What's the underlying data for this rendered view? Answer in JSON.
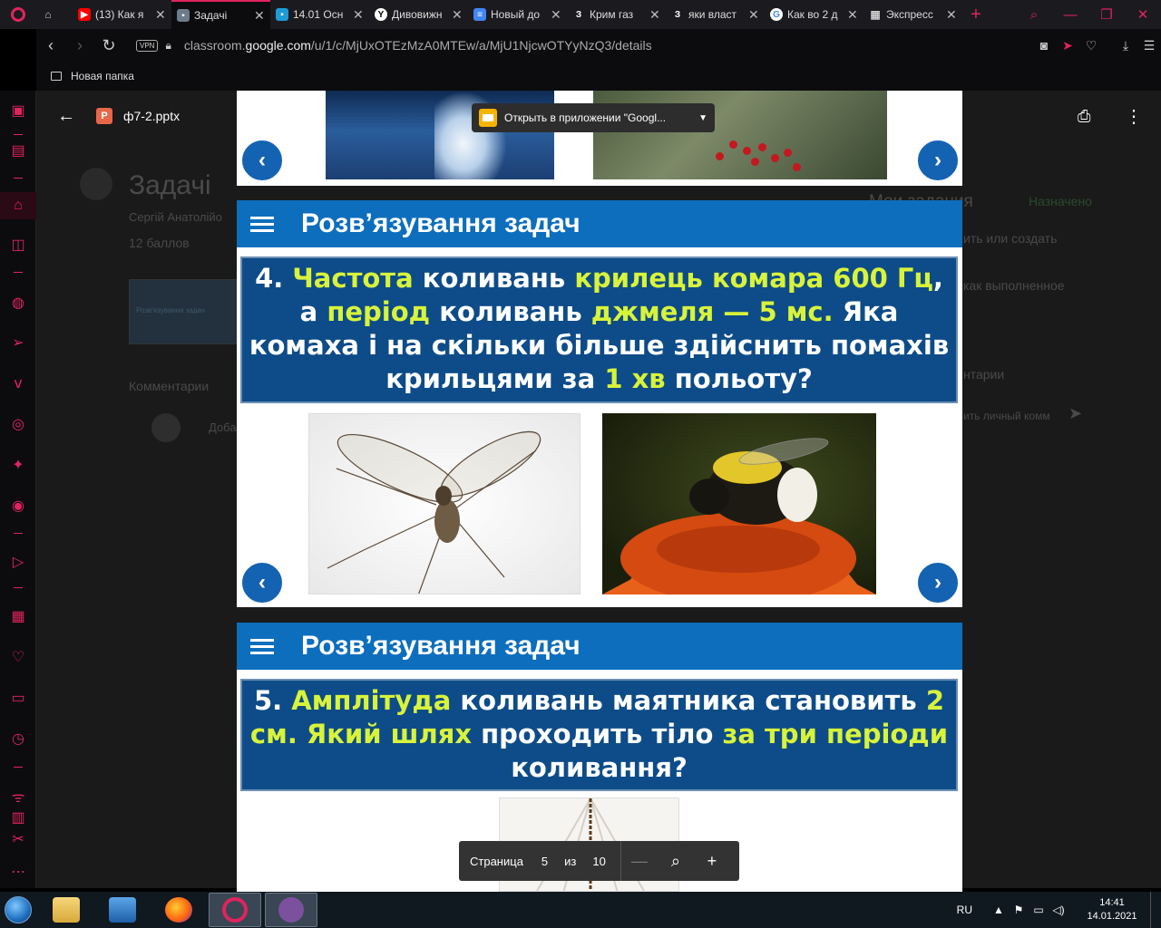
{
  "browser": {
    "tabs": [
      {
        "title": "",
        "favicon": "controller-icon",
        "color": "#1b1b1f"
      },
      {
        "title": "(13) Как я",
        "favicon": "youtube-icon",
        "color": "#ff0000"
      },
      {
        "title": "Задачі",
        "favicon": "classroom-icon",
        "color": "#1e8e3e",
        "active": true
      },
      {
        "title": "14.01 Осн",
        "favicon": "classroom-icon",
        "color": "#0f9d58"
      },
      {
        "title": "Дивовижн",
        "favicon": "yandex-icon",
        "color": "#ffffff"
      },
      {
        "title": "Новый до",
        "favicon": "docs-icon",
        "color": "#4285f4"
      },
      {
        "title": "Крим газ",
        "favicon": "z-icon",
        "color": "#1b1b1f"
      },
      {
        "title": "яки власт",
        "favicon": "z-icon",
        "color": "#1b1b1f"
      },
      {
        "title": "Как во 2 д",
        "favicon": "google-icon",
        "color": "#ffffff"
      },
      {
        "title": "Экспресс",
        "favicon": "grid-icon",
        "color": "#1b1b1f"
      }
    ],
    "tab_glyphs": {
      "z": "З",
      "close": "✕",
      "new_tab": "+"
    },
    "vpn_label": "VPN",
    "url_prefix": "classroom.",
    "url_domain": "google.com",
    "url_path": "/u/1/c/MjUxOTEzMzA0MTEw/a/MjU1NjcwOTYyNzQ3/details",
    "bookmark_folder": "Новая папка",
    "accent": "#e0245e"
  },
  "viewer": {
    "file_name": "ф7-2.pptx",
    "file_icon_letter": "P",
    "open_in_app": "Открыть в приложении \"Googl...",
    "page_label": "Страница",
    "page_current": "5",
    "page_of": "из",
    "page_total": "10"
  },
  "classroom_bg": {
    "title": "Задачі",
    "author": "Сергій Анатолійо",
    "points": "12 баллов",
    "attachment_title": "Розв'язування задач",
    "comments": "Комментарии",
    "comment_placeholder": "Доба",
    "my_work": "Мои задания",
    "assigned": "Назначено",
    "add_create": "ить или создать",
    "mark_done": "как выполненное",
    "private_comments": "нтарии",
    "private_placeholder": "ить личный комм"
  },
  "slides": [
    {
      "header": "Розв’язування задач",
      "question_parts": [
        {
          "t": "4.  ",
          "hl": false
        },
        {
          "t": "Частота",
          "hl": true
        },
        {
          "t": " коливань ",
          "hl": false
        },
        {
          "t": "крилець комара",
          "hl": true
        },
        {
          "t": " ",
          "hl": false
        },
        {
          "t": "600 Гц",
          "hl": true
        },
        {
          "t": ", а ",
          "hl": false
        },
        {
          "t": "період",
          "hl": true
        },
        {
          "t": " коливань ",
          "hl": false
        },
        {
          "t": "джмеля — 5 мс.",
          "hl": true
        },
        {
          "t": " Яка комаха і на скільки більше здійснить помахів крильцями за ",
          "hl": false
        },
        {
          "t": "1 хв",
          "hl": true
        },
        {
          "t": " польоту?",
          "hl": false
        }
      ]
    },
    {
      "header": "Розв’язування задач",
      "question_parts": [
        {
          "t": "5.  ",
          "hl": false
        },
        {
          "t": "Амплітуда",
          "hl": true
        },
        {
          "t": " коливань маятника становить ",
          "hl": false
        },
        {
          "t": "2 см. Який шлях",
          "hl": true
        },
        {
          "t": " проходить тіло ",
          "hl": false
        },
        {
          "t": "за три періоди",
          "hl": true
        },
        {
          "t": " коливання?",
          "hl": false
        }
      ]
    }
  ],
  "nav_glyphs": {
    "prev": "‹",
    "next": "›"
  },
  "taskbar": {
    "language": "RU",
    "time": "14:41",
    "date": "14.01.2021"
  },
  "colors": {
    "slide_header": "#0d6ebd",
    "question_bg": "#0d4c89",
    "highlight": "#d8f33a"
  }
}
